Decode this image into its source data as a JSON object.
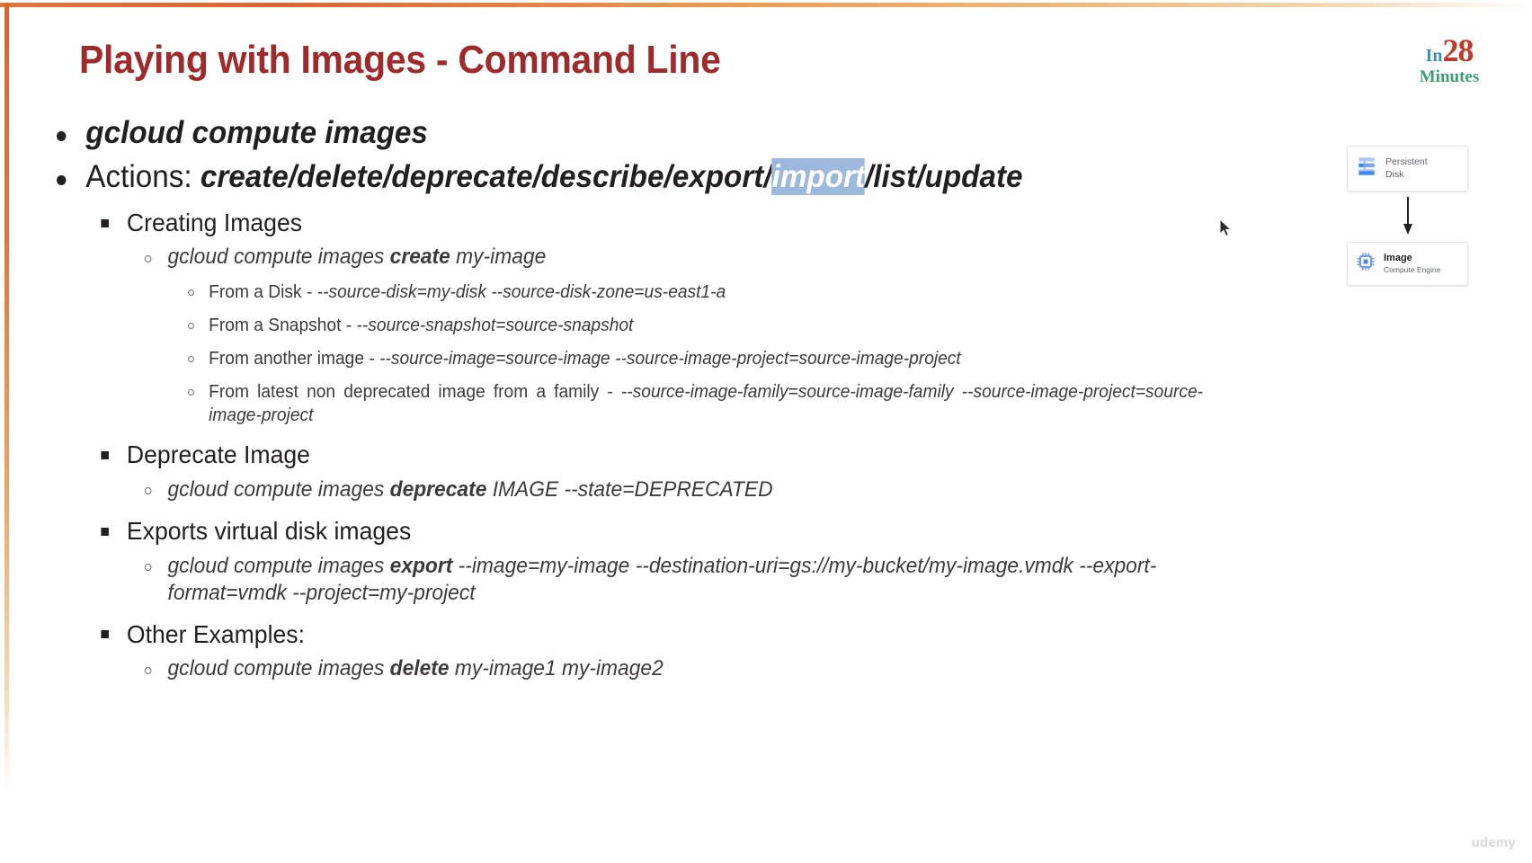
{
  "slide": {
    "title": "Playing with Images - Command Line",
    "title_color": "#9e2a2b",
    "accent_border_color": "#e2622c",
    "background_color": "#ffffff"
  },
  "logo": {
    "in": "In",
    "number": "28",
    "minutes": "Minutes",
    "in_color": "#3f8fae",
    "number_color": "#c0392b",
    "minutes_color": "#3d9f6e"
  },
  "bullets": {
    "b1": "gcloud compute images",
    "b2_label": "Actions: ",
    "b2_pre": "create/delete/deprecate/describe/export/",
    "b2_selected": "import",
    "b2_post": "/list/update",
    "selection_color": "#9db8dd"
  },
  "sections": [
    {
      "heading": "Creating Images",
      "command_pre": "gcloud compute images ",
      "command_bold": "create",
      "command_post": " my-image",
      "details": [
        {
          "label": "From a Disk - ",
          "args": "--source-disk=my-disk --source-disk-zone=us-east1-a"
        },
        {
          "label": "From a Snapshot - ",
          "args": "--source-snapshot=source-snapshot"
        },
        {
          "label": "From another image - ",
          "args": "--source-image=source-image --source-image-project=source-image-project"
        },
        {
          "label": "From latest non deprecated image from a family - ",
          "args": "--source-image-family=source-image-family --source-image-project=source-image-project"
        }
      ]
    },
    {
      "heading": "Deprecate Image",
      "command_pre": "gcloud compute images ",
      "command_bold": "deprecate",
      "command_post": " IMAGE --state=DEPRECATED",
      "details": []
    },
    {
      "heading": "Exports virtual disk images",
      "command_pre": "gcloud compute images ",
      "command_bold": "export",
      "command_post": " --image=my-image --destination-uri=gs://my-bucket/my-image.vmdk --export-format=vmdk --project=my-project",
      "details": []
    },
    {
      "heading": "Other Examples:",
      "command_pre": "gcloud compute images ",
      "command_bold": "delete",
      "command_post": " my-image1 my-image2",
      "details": []
    }
  ],
  "diagram": {
    "source": {
      "title": "Persistent",
      "subtitle": "Disk",
      "icon": "persistent-disk-icon"
    },
    "arrow": "down-arrow-icon",
    "target": {
      "title": "Image",
      "subtitle": "Compute Engine",
      "icon": "compute-engine-chip-icon"
    },
    "icon_color": "#5b8def"
  },
  "watermark": {
    "text": "udemy"
  }
}
